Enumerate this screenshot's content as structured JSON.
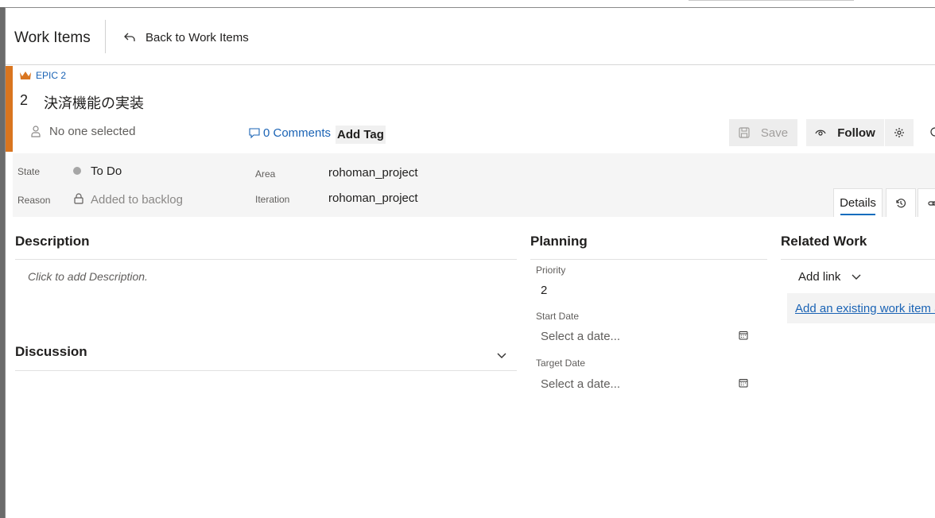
{
  "header": {
    "title": "Work Items",
    "back_label": "Back to Work Items"
  },
  "work_item": {
    "type_label": "EPIC 2",
    "id": "2",
    "title": "決済機能の実装",
    "assigned_to": "No one selected",
    "comments_label": "0 Comments",
    "add_tag_label": "Add Tag",
    "accent_color": "#d9751f"
  },
  "toolbar": {
    "save_label": "Save",
    "follow_label": "Follow"
  },
  "fields": {
    "state_label": "State",
    "state_value": "To Do",
    "reason_label": "Reason",
    "reason_value": "Added to backlog",
    "area_label": "Area",
    "area_value": "rohoman_project",
    "iteration_label": "Iteration",
    "iteration_value": "rohoman_project"
  },
  "tabs": {
    "details_label": "Details"
  },
  "description": {
    "heading": "Description",
    "placeholder": "Click to add Description."
  },
  "discussion": {
    "heading": "Discussion"
  },
  "planning": {
    "heading": "Planning",
    "priority_label": "Priority",
    "priority_value": "2",
    "start_label": "Start Date",
    "start_placeholder": "Select a date...",
    "target_label": "Target Date",
    "target_placeholder": "Select a date..."
  },
  "related": {
    "heading": "Related Work",
    "add_link_label": "Add link",
    "existing_label": "Add an existing work item as a parent"
  },
  "icons": [
    "undo-arrow-icon",
    "crown-icon",
    "person-icon",
    "comment-icon",
    "save-icon",
    "eye-icon",
    "gear-icon",
    "lock-icon",
    "history-icon",
    "link-icon",
    "chevron-down-icon",
    "calendar-icon"
  ]
}
